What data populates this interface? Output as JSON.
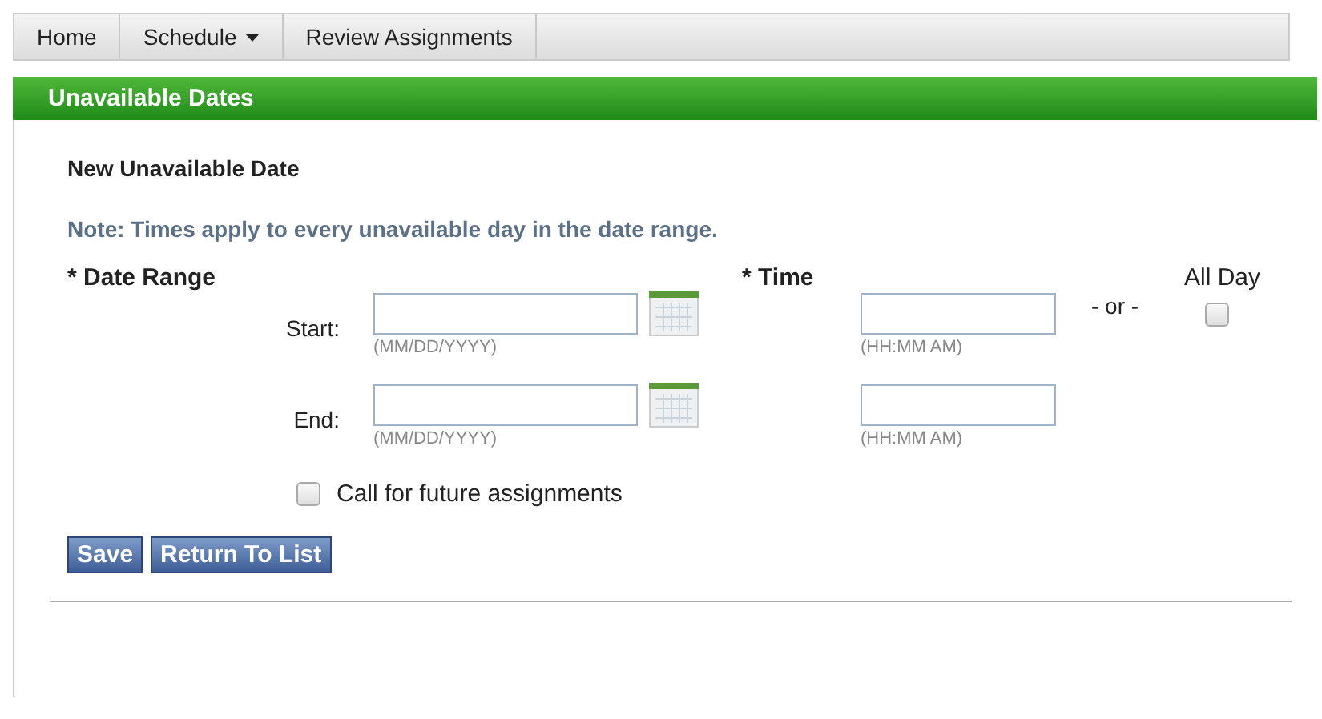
{
  "nav": [
    {
      "label": "Home",
      "has_menu": false
    },
    {
      "label": "Schedule",
      "has_menu": true
    },
    {
      "label": "Review Assignments",
      "has_menu": false
    }
  ],
  "header": {
    "title": "Unavailable Dates"
  },
  "form": {
    "title": "New Unavailable Date",
    "note": "Note: Times apply to every unavailable day in the date range.",
    "date_range_label": "* Date Range",
    "time_label": "* Time",
    "or_text": "- or -",
    "all_day": {
      "label": "All Day",
      "checked": false
    },
    "rows": [
      {
        "label": "Start:",
        "date_hint": "(MM/DD/YYYY)",
        "time_hint": "(HH:MM AM)"
      },
      {
        "label": "End:",
        "date_hint": "(MM/DD/YYYY)",
        "time_hint": "(HH:MM AM)"
      }
    ],
    "future": {
      "label": "Call for future assignments",
      "checked": false
    }
  },
  "buttons": [
    "Save",
    "Return To List"
  ]
}
